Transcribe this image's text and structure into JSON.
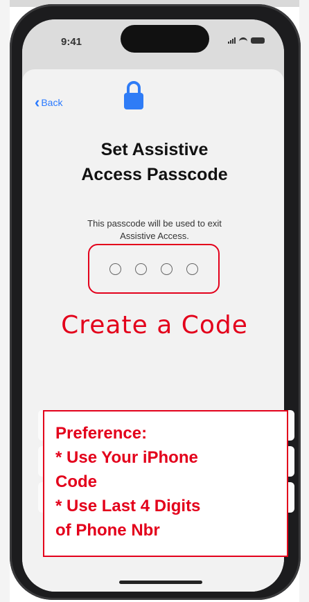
{
  "status_bar": {
    "time": "9:41"
  },
  "nav": {
    "back_label": "Back"
  },
  "header": {
    "icon": "lock-icon",
    "title_line1": "Set Assistive",
    "title_line2": "Access Passcode",
    "subtitle_line1": "This passcode will be used to exit",
    "subtitle_line2": "Assistive Access."
  },
  "passcode": {
    "digits_total": 4,
    "digits_entered": 0
  },
  "annotation": {
    "caption": "Create a Code",
    "preference_lines": [
      "Preference:",
      "* Use Your iPhone",
      "Code",
      "* Use Last 4 Digits",
      "of Phone Nbr"
    ]
  },
  "colors": {
    "accent": "#2979ff",
    "annotation": "#e3001b",
    "lock": "#2f7cf6"
  }
}
